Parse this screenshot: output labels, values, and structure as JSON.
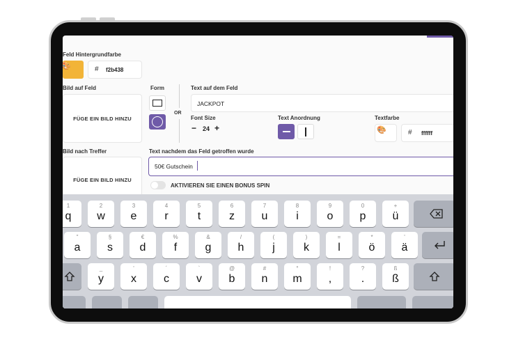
{
  "form": {
    "bg_color_label": "Feld Hintergrundfarbe",
    "bg_color_hash": "#",
    "bg_color_value": "f2b438",
    "image_on_field_label": "Bild auf Feld",
    "add_image_label": "FÜGE EIN BILD HINZU",
    "shape_label": "Form",
    "or_label": "OR",
    "text_on_field_label": "Text auf dem Feld",
    "text_on_field_value": "JACKPOT",
    "font_size_label": "Font Size",
    "font_size_minus": "−",
    "font_size_value": "24",
    "font_size_plus": "+",
    "text_alignment_label": "Text Anordnung",
    "text_color_label": "Textfarbe",
    "text_color_hash": "#",
    "text_color_value": "ffffff",
    "image_after_hit_label": "Bild nach Treffer",
    "add_image_label_2": "FÜGE EIN BILD HINZU",
    "text_after_hit_label": "Text nachdem das Feld getroffen wurde",
    "text_after_hit_value": "50€ Gutschein",
    "bonus_spin_label": "AKTIVIEREN SIE EINEN BONUS SPIN"
  },
  "colors": {
    "accent": "#6f5aa8",
    "field_bg": "#f2b438",
    "keyboard_bg": "#d2d4da"
  },
  "keyboard": {
    "row1": [
      {
        "hint": "1",
        "ch": "q"
      },
      {
        "hint": "2",
        "ch": "w"
      },
      {
        "hint": "3",
        "ch": "e"
      },
      {
        "hint": "4",
        "ch": "r"
      },
      {
        "hint": "5",
        "ch": "t"
      },
      {
        "hint": "6",
        "ch": "z"
      },
      {
        "hint": "7",
        "ch": "u"
      },
      {
        "hint": "8",
        "ch": "i"
      },
      {
        "hint": "9",
        "ch": "o"
      },
      {
        "hint": "0",
        "ch": "p"
      },
      {
        "hint": "+",
        "ch": "ü"
      }
    ],
    "row2": [
      {
        "hint": "\"",
        "ch": "a"
      },
      {
        "hint": "§",
        "ch": "s"
      },
      {
        "hint": "€",
        "ch": "d"
      },
      {
        "hint": "%",
        "ch": "f"
      },
      {
        "hint": "&",
        "ch": "g"
      },
      {
        "hint": "/",
        "ch": "h"
      },
      {
        "hint": "(",
        "ch": "j"
      },
      {
        "hint": ")",
        "ch": "k"
      },
      {
        "hint": "=",
        "ch": "l"
      },
      {
        "hint": "*",
        "ch": "ö"
      },
      {
        "hint": "'",
        "ch": "ä"
      }
    ],
    "row3": [
      {
        "hint": "_",
        "ch": "y"
      },
      {
        "hint": "'",
        "ch": "x"
      },
      {
        "hint": "´",
        "ch": "c"
      },
      {
        "hint": "`",
        "ch": "v"
      },
      {
        "hint": "@",
        "ch": "b"
      },
      {
        "hint": "#",
        "ch": "n"
      },
      {
        "hint": "°",
        "ch": "m"
      },
      {
        "hint": "!",
        "ch": ","
      },
      {
        "hint": "?",
        "ch": "."
      },
      {
        "hint": "ß",
        "ch": "ß"
      }
    ],
    "backspace_icon": "backspace-icon",
    "return_icon": "return-icon",
    "shift_icon": "shift-icon"
  }
}
